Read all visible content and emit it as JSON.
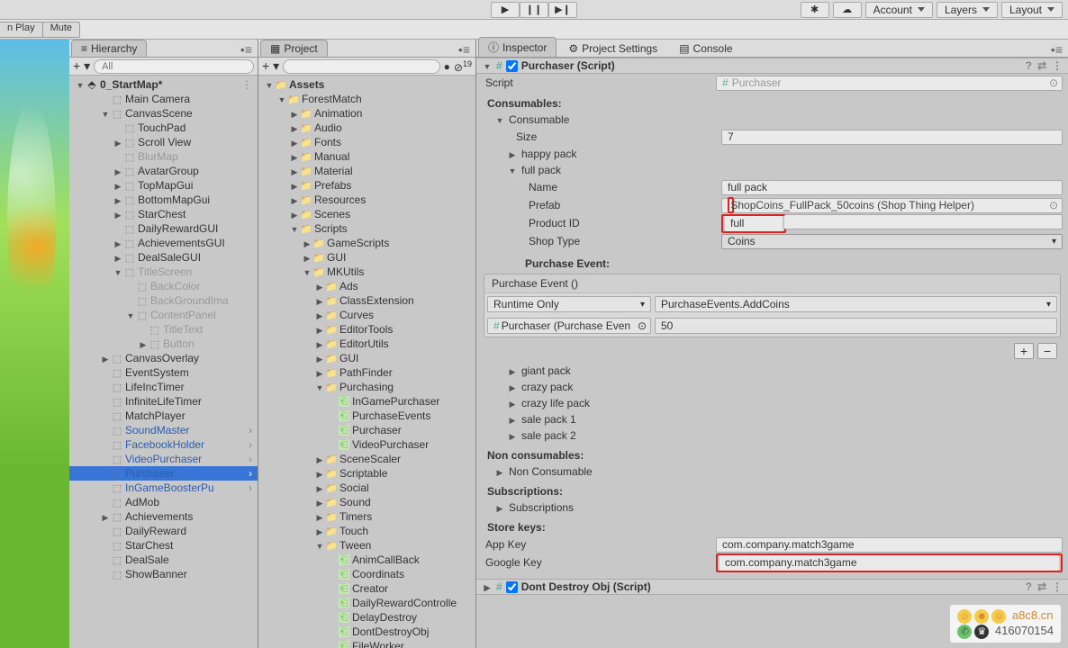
{
  "toolbar": {
    "play": "▶",
    "pause": "❙❙",
    "step": "▶❙",
    "snow": "✱",
    "cloud": "☁",
    "account": "Account",
    "layers": "Layers",
    "layout": "Layout"
  },
  "row2": {
    "n_play": "n Play",
    "mute": "Mute"
  },
  "hierarchy": {
    "tab": "Hierarchy",
    "search_placeholder": "All",
    "scene": "0_StartMap*",
    "items": [
      {
        "l": 2,
        "n": "Main Camera",
        "ico": "cube"
      },
      {
        "l": 2,
        "n": "CanvasScene",
        "ico": "cube",
        "tw": "open"
      },
      {
        "l": 3,
        "n": "TouchPad",
        "ico": "cube"
      },
      {
        "l": 3,
        "n": "Scroll View",
        "ico": "cube",
        "tw": "closed"
      },
      {
        "l": 3,
        "n": "BlurMap",
        "ico": "cube",
        "faded": true
      },
      {
        "l": 3,
        "n": "AvatarGroup",
        "ico": "cube",
        "tw": "closed"
      },
      {
        "l": 3,
        "n": "TopMapGui",
        "ico": "cube",
        "tw": "closed"
      },
      {
        "l": 3,
        "n": "BottomMapGui",
        "ico": "cube",
        "tw": "closed"
      },
      {
        "l": 3,
        "n": "StarChest",
        "ico": "cube",
        "tw": "closed"
      },
      {
        "l": 3,
        "n": "DailyRewardGUI",
        "ico": "cube"
      },
      {
        "l": 3,
        "n": "AchievementsGUI",
        "ico": "cube",
        "tw": "closed"
      },
      {
        "l": 3,
        "n": "DealSaleGUI",
        "ico": "cube",
        "tw": "closed"
      },
      {
        "l": 3,
        "n": "TitleScreen",
        "ico": "cube",
        "tw": "open",
        "faded": true
      },
      {
        "l": 4,
        "n": "BackColor",
        "ico": "cube",
        "faded": true
      },
      {
        "l": 4,
        "n": "BackGroundIma",
        "ico": "cube",
        "faded": true
      },
      {
        "l": 4,
        "n": "ContentPanel",
        "ico": "cube",
        "tw": "open",
        "faded": true
      },
      {
        "l": 5,
        "n": "TitleText",
        "ico": "cube",
        "faded": true
      },
      {
        "l": 5,
        "n": "Button",
        "ico": "cube",
        "tw": "closed",
        "faded": true
      },
      {
        "l": 2,
        "n": "CanvasOverlay",
        "ico": "cube",
        "tw": "closed"
      },
      {
        "l": 2,
        "n": "EventSystem",
        "ico": "cube"
      },
      {
        "l": 2,
        "n": "LifeIncTimer",
        "ico": "cube"
      },
      {
        "l": 2,
        "n": "InfiniteLifeTimer",
        "ico": "cube"
      },
      {
        "l": 2,
        "n": "MatchPlayer",
        "ico": "cube"
      },
      {
        "l": 2,
        "n": "SoundMaster",
        "ico": "cube",
        "blue": true,
        "arrow": true
      },
      {
        "l": 2,
        "n": "FacebookHolder",
        "ico": "cube",
        "blue": true,
        "arrow": true
      },
      {
        "l": 2,
        "n": "VideoPurchaser",
        "ico": "cube",
        "blue": true,
        "arrow": true
      },
      {
        "l": 2,
        "n": "Purchaser",
        "ico": "cube",
        "blue": true,
        "arrow": true,
        "selected": true
      },
      {
        "l": 2,
        "n": "InGameBoosterPu",
        "ico": "cube",
        "blue": true,
        "arrow": true
      },
      {
        "l": 2,
        "n": "AdMob",
        "ico": "cube"
      },
      {
        "l": 2,
        "n": "Achievements",
        "ico": "cube",
        "tw": "closed"
      },
      {
        "l": 2,
        "n": "DailyReward",
        "ico": "cube"
      },
      {
        "l": 2,
        "n": "StarChest",
        "ico": "cube"
      },
      {
        "l": 2,
        "n": "DealSale",
        "ico": "cube"
      },
      {
        "l": 2,
        "n": "ShowBanner",
        "ico": "cube"
      }
    ]
  },
  "project": {
    "tab": "Project",
    "count": "19",
    "root": "Assets",
    "items": [
      {
        "l": 1,
        "n": "ForestMatch",
        "ico": "folder",
        "tw": "open"
      },
      {
        "l": 2,
        "n": "Animation",
        "ico": "folder",
        "tw": "closed"
      },
      {
        "l": 2,
        "n": "Audio",
        "ico": "folder",
        "tw": "closed"
      },
      {
        "l": 2,
        "n": "Fonts",
        "ico": "folder",
        "tw": "closed"
      },
      {
        "l": 2,
        "n": "Manual",
        "ico": "folder",
        "tw": "closed"
      },
      {
        "l": 2,
        "n": "Material",
        "ico": "folder",
        "tw": "closed"
      },
      {
        "l": 2,
        "n": "Prefabs",
        "ico": "folder",
        "tw": "closed"
      },
      {
        "l": 2,
        "n": "Resources",
        "ico": "folder",
        "tw": "closed"
      },
      {
        "l": 2,
        "n": "Scenes",
        "ico": "folder",
        "tw": "closed"
      },
      {
        "l": 2,
        "n": "Scripts",
        "ico": "folder",
        "tw": "open"
      },
      {
        "l": 3,
        "n": "GameScripts",
        "ico": "folder",
        "tw": "closed"
      },
      {
        "l": 3,
        "n": "GUI",
        "ico": "folder",
        "tw": "closed"
      },
      {
        "l": 3,
        "n": "MKUtils",
        "ico": "folder",
        "tw": "open"
      },
      {
        "l": 4,
        "n": "Ads",
        "ico": "folder",
        "tw": "closed"
      },
      {
        "l": 4,
        "n": "ClassExtension",
        "ico": "folder",
        "tw": "closed"
      },
      {
        "l": 4,
        "n": "Curves",
        "ico": "folder",
        "tw": "closed"
      },
      {
        "l": 4,
        "n": "EditorTools",
        "ico": "folder",
        "tw": "closed"
      },
      {
        "l": 4,
        "n": "EditorUtils",
        "ico": "folder",
        "tw": "closed"
      },
      {
        "l": 4,
        "n": "GUI",
        "ico": "folder",
        "tw": "closed"
      },
      {
        "l": 4,
        "n": "PathFinder",
        "ico": "folder",
        "tw": "closed"
      },
      {
        "l": 4,
        "n": "Purchasing",
        "ico": "folder",
        "tw": "open"
      },
      {
        "l": 5,
        "n": "InGamePurchaser",
        "ico": "script"
      },
      {
        "l": 5,
        "n": "PurchaseEvents",
        "ico": "script"
      },
      {
        "l": 5,
        "n": "Purchaser",
        "ico": "script"
      },
      {
        "l": 5,
        "n": "VideoPurchaser",
        "ico": "script"
      },
      {
        "l": 4,
        "n": "SceneScaler",
        "ico": "folder",
        "tw": "closed"
      },
      {
        "l": 4,
        "n": "Scriptable",
        "ico": "folder",
        "tw": "closed"
      },
      {
        "l": 4,
        "n": "Social",
        "ico": "folder",
        "tw": "closed"
      },
      {
        "l": 4,
        "n": "Sound",
        "ico": "folder",
        "tw": "closed"
      },
      {
        "l": 4,
        "n": "Timers",
        "ico": "folder",
        "tw": "closed"
      },
      {
        "l": 4,
        "n": "Touch",
        "ico": "folder",
        "tw": "closed"
      },
      {
        "l": 4,
        "n": "Tween",
        "ico": "folder",
        "tw": "open"
      },
      {
        "l": 5,
        "n": "AnimCallBack",
        "ico": "script"
      },
      {
        "l": 5,
        "n": "Coordinats",
        "ico": "script"
      },
      {
        "l": 5,
        "n": "Creator",
        "ico": "script"
      },
      {
        "l": 5,
        "n": "DailyRewardControlle",
        "ico": "script"
      },
      {
        "l": 5,
        "n": "DelayDestroy",
        "ico": "script"
      },
      {
        "l": 5,
        "n": "DontDestroyObj",
        "ico": "script"
      },
      {
        "l": 5,
        "n": "FileWorker",
        "ico": "script"
      }
    ]
  },
  "inspector": {
    "tab": "Inspector",
    "tab2": "Project Settings",
    "tab3": "Console",
    "component": "Purchaser (Script)",
    "script_label": "Script",
    "script_value": "Purchaser",
    "consumables_label": "Consumables:",
    "consumable_label": "Consumable",
    "size_label": "Size",
    "size_value": "7",
    "happy_pack": "happy pack",
    "full_pack": "full pack",
    "name_label": "Name",
    "name_value": "full pack",
    "prefab_label": "Prefab",
    "prefab_value": "ShopCoins_FullPack_50coins (Shop Thing Helper)",
    "productid_label": "Product ID",
    "productid_value": "full",
    "shoptype_label": "Shop Type",
    "shoptype_value": "Coins",
    "purchase_event_label": "Purchase Event:",
    "purchase_event_head": "Purchase Event ()",
    "runtime_only": "Runtime Only",
    "event_target": "Purchaser (Purchase Even",
    "event_function": "PurchaseEvents.AddCoins",
    "event_arg": "50",
    "packs": [
      "giant pack",
      "crazy pack",
      "crazy life pack",
      "sale pack 1",
      "sale pack 2"
    ],
    "non_consumables_label": "Non consumables:",
    "non_consumable": "Non Consumable",
    "subscriptions_label": "Subscriptions:",
    "subscriptions": "Subscriptions",
    "store_keys_label": "Store keys:",
    "appkey_label": "App Key",
    "appkey_value": "com.company.match3game",
    "googlekey_label": "Google Key",
    "googlekey_value": "com.company.match3game",
    "dont_destroy": "Dont Destroy Obj (Script)"
  },
  "watermark": {
    "line1": "a8c8.cn",
    "line2": "416070154"
  }
}
